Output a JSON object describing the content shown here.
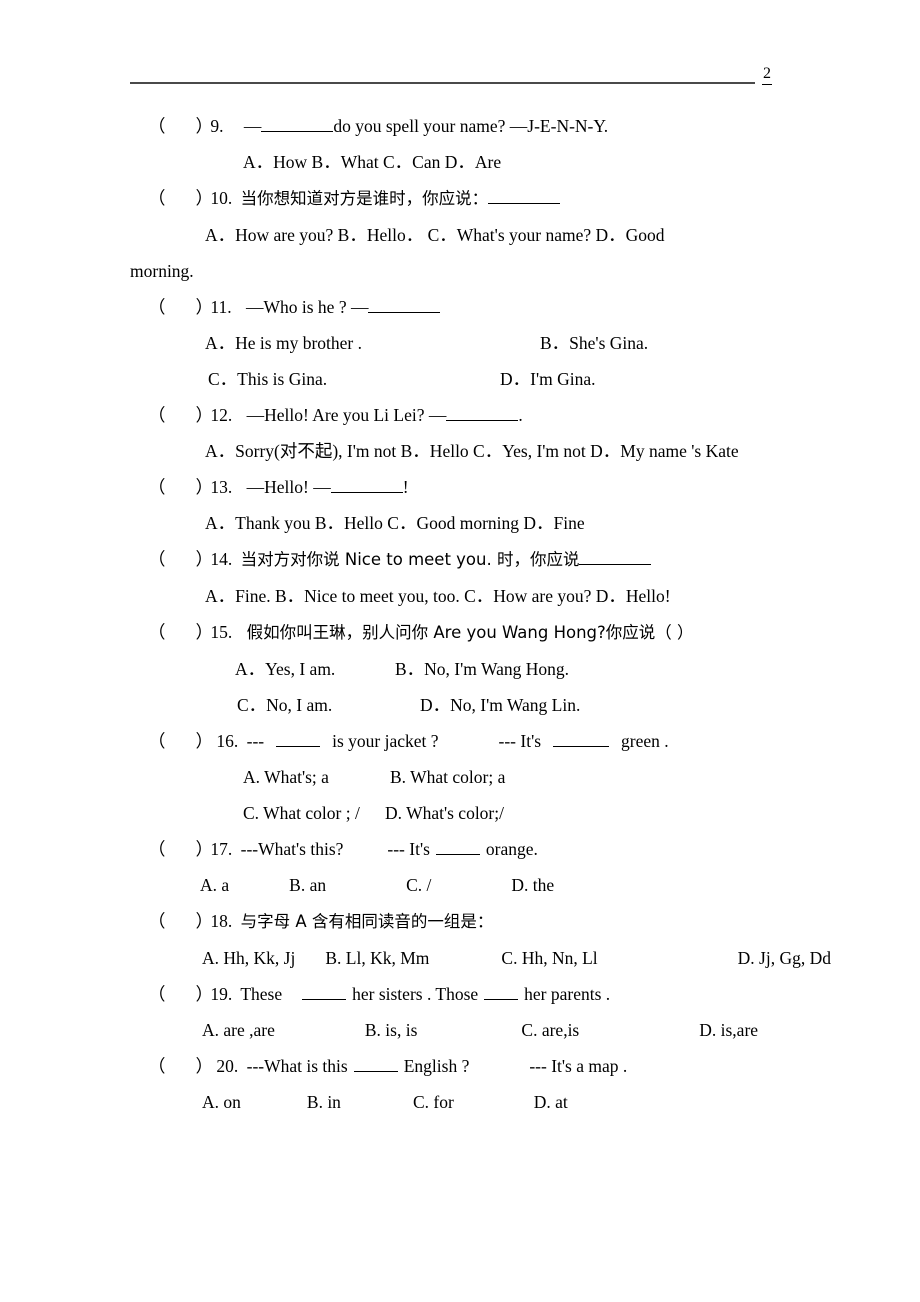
{
  "document": {
    "page_number": "2",
    "type": "exam-paper",
    "marker_open": "（",
    "marker_close": "）"
  },
  "questions": [
    {
      "number": "9.",
      "stem_before": "—",
      "stem_after": "do you spell your name?  —J-E-N-N-Y.",
      "options_inline": "A．How    B．What   C．Can  D．Are",
      "options": [
        "A．How",
        "B．What",
        "C．Can",
        "D．Are"
      ]
    },
    {
      "number": "10.",
      "stem_zh": "当你想知道对方是谁时，你应说：",
      "options_line1": "A．How are you?  B．Hello．   C．What's your name?  D．Good",
      "options_line2": "morning.",
      "options": [
        "A．How are you?",
        "B．Hello．",
        "C．What's your name?",
        "D．Good morning."
      ]
    },
    {
      "number": "11.",
      "stem_before": "—Who is he ?  —",
      "option_a": "A．He is my brother .",
      "option_b": "B．She's Gina.",
      "option_c": "C．This is Gina.",
      "option_d": "D．I'm   Gina."
    },
    {
      "number": "12.",
      "stem_before": "—Hello! Are you Li Lei? —",
      "stem_after": ".",
      "options_inline": "A．Sorry(对不起), I'm not  B．Hello    C．Yes, I'm not  D．My name 's Kate",
      "options": [
        "A．Sorry(对不起), I'm not",
        "B．Hello",
        "C．Yes, I'm not",
        "D．My name 's Kate"
      ]
    },
    {
      "number": "13.",
      "stem_before": "—Hello!     —",
      "stem_after": "!",
      "options_inline": "A．Thank you     B．Hello  C．Good morning     D．Fine",
      "options": [
        "A．Thank you",
        "B．Hello",
        "C．Good morning",
        "D．Fine"
      ]
    },
    {
      "number": "14.",
      "stem_zh_before": "当对方对你说 Nice to meet you. 时，你应说",
      "options_inline": "A．Fine.  B．Nice to meet you, too. C．How are you?    D．Hello!",
      "options": [
        "A．Fine.",
        "B．Nice to meet you, too.",
        "C．How are you?",
        "D．Hello!"
      ]
    },
    {
      "number": "15.",
      "stem_zh": "假如你叫王琳，别人问你 Are you Wang Hong?你应说（    ）",
      "option_a": "A．Yes, I am.",
      "option_b": "B．No, I'm Wang Hong.",
      "option_c": "C．No, I am.",
      "option_d": "D．No, I'm Wang Lin."
    },
    {
      "number": "16.",
      "stem_p1": "---",
      "stem_p2": "is   your   jacket ?",
      "stem_p3": "--- It's",
      "stem_p4": "green .",
      "option_a": "A. What's; a",
      "option_b": "B. What color; a",
      "option_c": "C. What color ; /",
      "option_d": "D. What's color;/"
    },
    {
      "number": "17.",
      "stem_p1": "---What's this?",
      "stem_p2": "--- It's",
      "stem_p3": "orange.",
      "options": [
        "A. a",
        "B. an",
        "C. /",
        "D. the"
      ]
    },
    {
      "number": "18.",
      "stem_zh": "与字母 A 含有相同读音的一组是：",
      "options": [
        "A.   Hh, Kk, Jj",
        "B. Ll, Kk, Mm",
        "C. Hh, Nn, Ll",
        "D. Jj, Gg, Dd"
      ]
    },
    {
      "number": "19.",
      "stem_p1": "These",
      "stem_p2": "her sisters . Those",
      "stem_p3": "her parents .",
      "options": [
        "A. are ,are",
        "B. is, is",
        "C. are,is",
        "D. is,are"
      ]
    },
    {
      "number": "20.",
      "stem_p1": "---What   is    this",
      "stem_p2": "English ?",
      "stem_p3": "--- It's   a   map .",
      "options": [
        "A. on",
        "B. in",
        "C. for",
        "D. at"
      ]
    }
  ]
}
